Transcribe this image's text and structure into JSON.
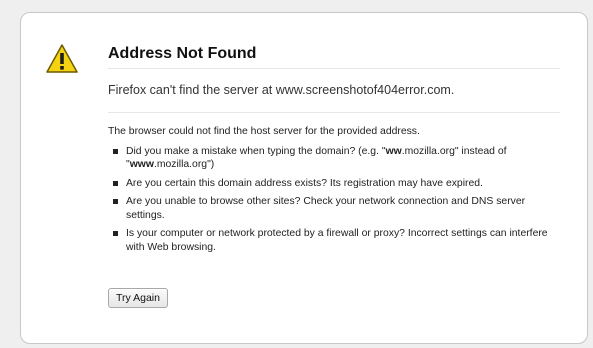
{
  "error": {
    "title": "Address Not Found",
    "short_desc": "Firefox can't find the server at www.screenshotof404error.com.",
    "long_desc_intro": "The browser could not find the host server for the provided address.",
    "suggestions": [
      {
        "prefix": "Did you make a mistake when typing the domain? (e.g. \"",
        "strong1": "ww",
        "middle": ".mozilla.org\" instead of \"",
        "strong2": "www",
        "suffix": ".mozilla.org\")"
      },
      {
        "text": "Are you certain this domain address exists? Its registration may have expired."
      },
      {
        "text": "Are you unable to browse other sites? Check your network connection and DNS server settings."
      },
      {
        "text": "Is your computer or network protected by a firewall or proxy? Incorrect settings can interfere with Web browsing."
      }
    ],
    "try_again_label": "Try Again"
  },
  "icons": {
    "warning": "warning-icon"
  },
  "colors": {
    "warning_yellow": "#f5d311",
    "warning_border": "#6b5a00"
  }
}
